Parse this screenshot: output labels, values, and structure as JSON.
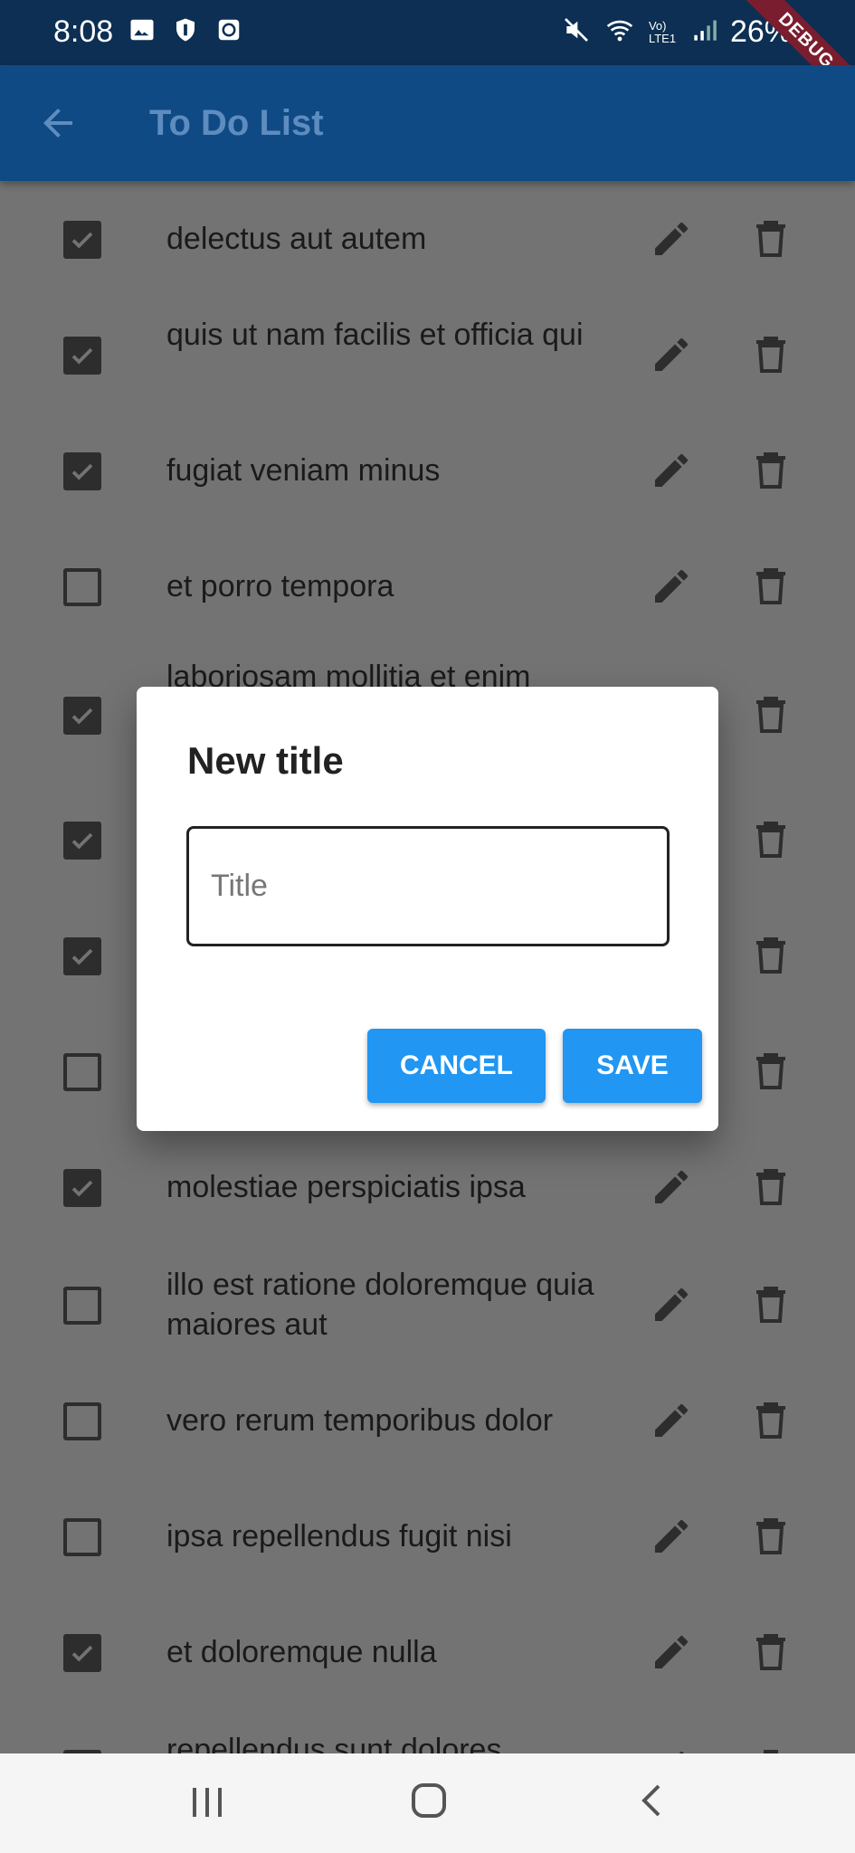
{
  "status_bar": {
    "time": "8:08",
    "battery": "26%",
    "network_label": "Vo) LTE1",
    "debug_label": "DEBUG"
  },
  "app_bar": {
    "title": "To Do List"
  },
  "todos": [
    {
      "text": "delectus aut autem",
      "checked": true
    },
    {
      "text": "quis ut nam facilis et officia qui",
      "checked": true
    },
    {
      "text": "fugiat veniam minus",
      "checked": true
    },
    {
      "text": "et porro tempora",
      "checked": false
    },
    {
      "text": "laboriosam mollitia et enim",
      "checked": true
    },
    {
      "text": "",
      "checked": true
    },
    {
      "text": "",
      "checked": true
    },
    {
      "text": "",
      "checked": false
    },
    {
      "text": "molestiae perspiciatis ipsa",
      "checked": true
    },
    {
      "text": "illo est ratione doloremque quia maiores aut",
      "checked": false
    },
    {
      "text": "vero rerum temporibus dolor",
      "checked": false
    },
    {
      "text": "ipsa repellendus fugit nisi",
      "checked": false
    },
    {
      "text": "et doloremque nulla",
      "checked": true
    },
    {
      "text": "repellendus sunt dolores",
      "checked": false
    }
  ],
  "dialog": {
    "title": "New title",
    "input_placeholder": "Title",
    "input_value": "",
    "cancel_label": "CANCEL",
    "save_label": "SAVE"
  },
  "colors": {
    "app_bar": "#0f4a84",
    "status_bar": "#0c2f53",
    "accent_button": "#2196f3",
    "scrim_background": "#737373"
  }
}
